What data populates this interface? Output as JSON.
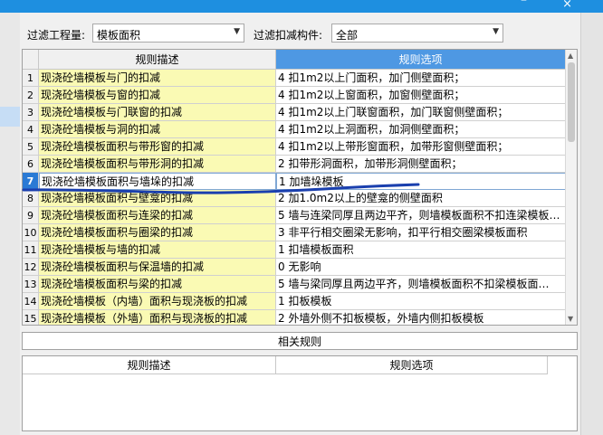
{
  "titlebar": {
    "minimize": "–",
    "close": "×"
  },
  "filters": {
    "quantity_label": "过滤工程量:",
    "quantity_value": "模板面积",
    "component_label": "过滤扣减构件:",
    "component_value": "全部"
  },
  "table": {
    "col_desc": "规则描述",
    "col_option": "规则选项",
    "selected_row": 7,
    "rows": [
      {
        "n": "1",
        "desc": "现浇砼墙模板与门的扣减",
        "opt": "4   扣1m2以上门面积，加门侧壁面积；"
      },
      {
        "n": "2",
        "desc": "现浇砼墙模板与窗的扣减",
        "opt": "4   扣1m2以上窗面积，加窗侧壁面积；"
      },
      {
        "n": "3",
        "desc": "现浇砼墙模板与门联窗的扣减",
        "opt": "4   扣1m2以上门联窗面积，加门联窗侧壁面积；"
      },
      {
        "n": "4",
        "desc": "现浇砼墙模板与洞的扣减",
        "opt": "4   扣1m2以上洞面积，加洞侧壁面积；"
      },
      {
        "n": "5",
        "desc": "现浇砼墙模板面积与带形窗的扣减",
        "opt": "4   扣1m2以上带形窗面积，加带形窗侧壁面积；"
      },
      {
        "n": "6",
        "desc": "现浇砼墙模板面积与带形洞的扣减",
        "opt": "2   扣带形洞面积，加带形洞侧壁面积；"
      },
      {
        "n": "7",
        "desc": "现浇砼墙模板面积与墙垛的扣减",
        "opt": "1   加墙垛模板"
      },
      {
        "n": "8",
        "desc": "现浇砼墙模板面积与壁龛的扣减",
        "opt": "2   加1.0m2以上的壁龛的侧壁面积"
      },
      {
        "n": "9",
        "desc": "现浇砼墙模板面积与连梁的扣减",
        "opt": "5  墙与连梁同厚且两边平齐，则墙模板面积不扣连梁模板…"
      },
      {
        "n": "10",
        "desc": "现浇砼墙模板面积与圈梁的扣减",
        "opt": "3   非平行相交圈梁无影响，扣平行相交圈梁模板面积"
      },
      {
        "n": "11",
        "desc": "现浇砼墙模板与墙的扣减",
        "opt": "1   扣墙模板面积"
      },
      {
        "n": "12",
        "desc": "现浇砼墙模板面积与保温墙的扣减",
        "opt": "0   无影响"
      },
      {
        "n": "13",
        "desc": "现浇砼墙模板面积与梁的扣减",
        "opt": "5   墙与梁同厚且两边平齐，则墙模板面积不扣梁模板面…"
      },
      {
        "n": "14",
        "desc": "现浇砼墙模板（内墙）面积与现浇板的扣减",
        "opt": "1   扣板模板"
      },
      {
        "n": "15",
        "desc": "现浇砼墙模板（外墙）面积与现浇板的扣减",
        "opt": "2   外墙外侧不扣板模板，外墙内侧扣板模板"
      }
    ]
  },
  "related": {
    "button_label": "相关规则",
    "col_desc": "规则描述",
    "col_option": "规则选项"
  },
  "colors": {
    "desc_bg": "#fafab4",
    "header_active": "#4e98e3",
    "selected_row": "#2a7ad5",
    "annotation_ink": "#1a3fae"
  }
}
